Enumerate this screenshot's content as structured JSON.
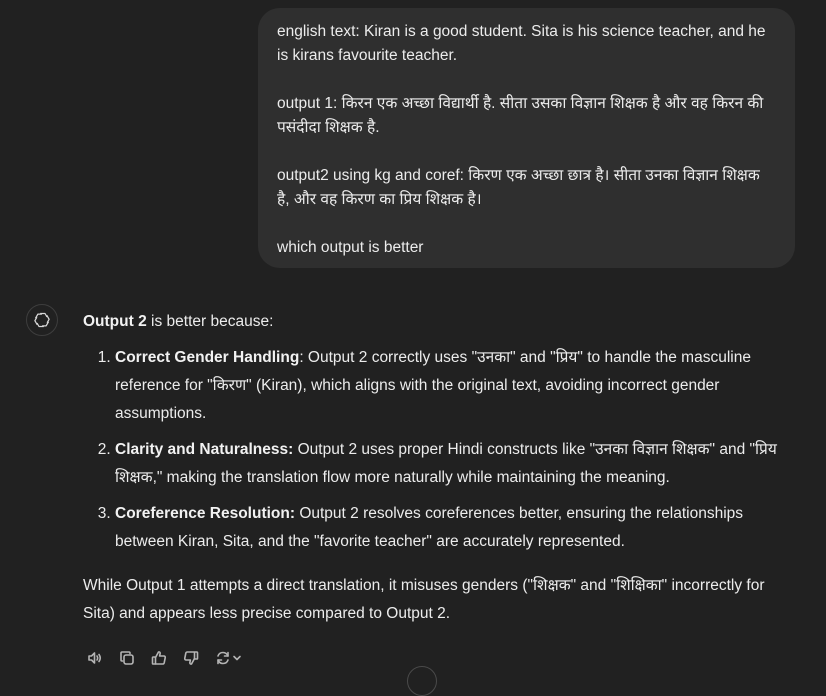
{
  "user_message": {
    "line1": "english text: Kiran is a good student. Sita is his science teacher, and he is kirans favourite teacher.",
    "line2": "output 1: किरन एक अच्छा विद्यार्थी है. सीता उसका विज्ञान शिक्षक है और वह किरन की पसंदीदा शिक्षक है.",
    "line3": "output2 using kg and coref: किरण एक अच्छा छात्र है। सीता उनका विज्ञान शिक्षक है, और वह किरण का प्रिय शिक्षक है।",
    "line4": "which output is better"
  },
  "assistant": {
    "intro_bold": "Output 2",
    "intro_rest": " is better because:",
    "points": [
      {
        "title": "Correct Gender Handling",
        "text": ": Output 2 correctly uses \"उनका\" and \"प्रिय\" to handle the masculine reference for \"किरण\" (Kiran), which aligns with the original text, avoiding incorrect gender assumptions."
      },
      {
        "title": "Clarity and Naturalness:",
        "text": " Output 2 uses proper Hindi constructs like \"उनका विज्ञान शिक्षक\" and \"प्रिय शिक्षक,\" making the translation flow more naturally while maintaining the meaning."
      },
      {
        "title": "Coreference Resolution:",
        "text": " Output 2 resolves coreferences better, ensuring the relationships between Kiran, Sita, and the \"favorite teacher\" are accurately represented."
      }
    ],
    "closing": "While Output 1 attempts a direct translation, it misuses genders (\"शिक्षक\" and \"शिक्षिका\" incorrectly for Sita) and appears less precise compared to Output 2."
  },
  "action_icons": [
    "read-aloud-icon",
    "copy-icon",
    "thumbs-up-icon",
    "thumbs-down-icon",
    "regenerate-icon"
  ]
}
